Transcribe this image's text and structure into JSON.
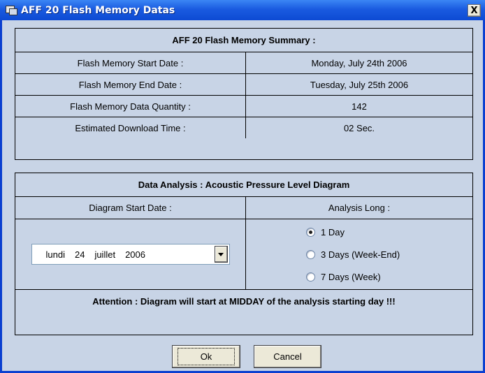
{
  "window": {
    "title": "AFF 20 Flash Memory Datas",
    "close_label": "X"
  },
  "summary": {
    "header": "AFF 20 Flash Memory Summary :",
    "rows": [
      {
        "label": "Flash Memory Start Date :",
        "value": "Monday, July 24th 2006"
      },
      {
        "label": "Flash Memory End Date :",
        "value": "Tuesday, July 25th 2006"
      },
      {
        "label": "Flash Memory Data Quantity :",
        "value": "142"
      },
      {
        "label": "Estimated Download Time :",
        "value": "02 Sec."
      }
    ]
  },
  "analysis": {
    "header": "Data Analysis : Acoustic Pressure Level Diagram",
    "start_label": "Diagram Start Date :",
    "long_label": "Analysis Long :",
    "date_picker": {
      "weekday": "lundi",
      "day": "24",
      "month": "juillet",
      "year": "2006"
    },
    "options": [
      {
        "label": "1 Day",
        "checked": true
      },
      {
        "label": "3 Days (Week-End)",
        "checked": false
      },
      {
        "label": "7 Days (Week)",
        "checked": false
      }
    ],
    "attention": "Attention : Diagram will start at MIDDAY of the analysis starting day !!!"
  },
  "buttons": {
    "ok": "Ok",
    "cancel": "Cancel"
  }
}
